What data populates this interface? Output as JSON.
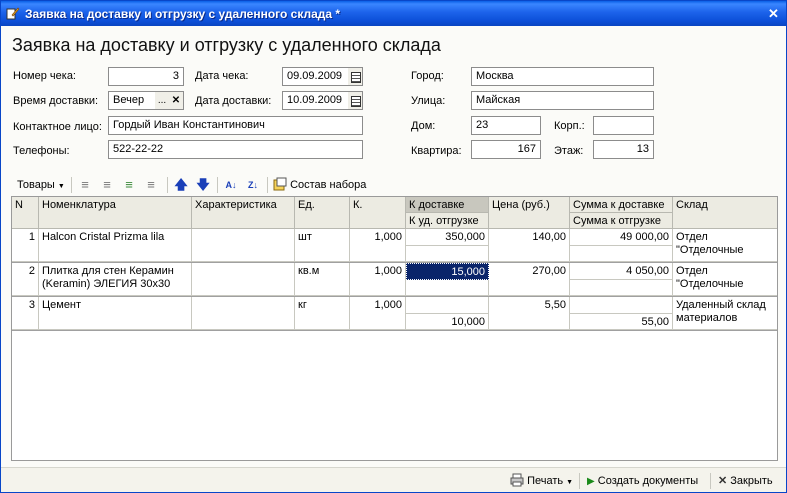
{
  "window": {
    "title": "Заявка на доставку и отгрузку с удаленного склада *",
    "close": "✕"
  },
  "form": {
    "title": "Заявка на доставку и отгрузку с удаленного склада",
    "fields": {
      "check_number_label": "Номер чека:",
      "check_number": "3",
      "check_date_label": "Дата чека:",
      "check_date": "09.09.2009",
      "delivery_time_label": "Время доставки:",
      "delivery_time": "Вечер",
      "delivery_date_label": "Дата доставки:",
      "delivery_date": "10.09.2009",
      "contact_label": "Контактное лицо:",
      "contact": "Гордый Иван Константинович",
      "phones_label": "Телефоны:",
      "phones": "522-22-22",
      "city_label": "Город:",
      "city": "Москва",
      "street_label": "Улица:",
      "street": "Майская",
      "house_label": "Дом:",
      "house": "23",
      "building_label": "Корп.:",
      "building": "",
      "apartment_label": "Квартира:",
      "apartment": "167",
      "floor_label": "Этаж:",
      "floor": "13"
    },
    "select_button": "...",
    "clear_button": "✕"
  },
  "toolbar": {
    "goods_label": "Товары",
    "kit_label": "Состав набора"
  },
  "table": {
    "headers": {
      "n": "N",
      "nomenclature": "Номенклатура",
      "characteristic": "Характеристика",
      "unit": "Ед.",
      "qty": "К.",
      "to_delivery": "К доставке",
      "to_shipment": "К уд. отгрузке",
      "price": "Цена (руб.)",
      "sum_delivery": "Сумма к доставке",
      "sum_shipment": "Сумма к отгрузке",
      "warehouse": "Склад"
    },
    "rows": [
      {
        "n": "1",
        "name": "Halcon Cristal Prizma lila",
        "characteristic": "",
        "unit": "шт",
        "qty": "1,000",
        "to_delivery": "350,000",
        "to_shipment": "",
        "price": "140,00",
        "sum_delivery": "49 000,00",
        "sum_shipment": "",
        "warehouse": "Отдел \"Отделочные"
      },
      {
        "n": "2",
        "name": "Плитка для стен Керамин (Keramin) ЭЛЕГИЯ 30x30",
        "characteristic": "",
        "unit": "кв.м",
        "qty": "1,000",
        "to_delivery": "15,000",
        "to_shipment": "",
        "price": "270,00",
        "sum_delivery": "4 050,00",
        "sum_shipment": "",
        "warehouse": "Отдел \"Отделочные"
      },
      {
        "n": "3",
        "name": "Цемент",
        "characteristic": "",
        "unit": "кг",
        "qty": "1,000",
        "to_delivery": "",
        "to_shipment": "10,000",
        "price": "5,50",
        "sum_delivery": "",
        "sum_shipment": "55,00",
        "warehouse": "Удаленный склад материалов"
      }
    ]
  },
  "footer": {
    "print_label": "Печать",
    "create_docs_label": "Создать документы",
    "close_label": "Закрыть"
  },
  "colors": {
    "titlebar": "#0c4fd8",
    "selection": "#0a246a",
    "accent_green": "#1a8a1a",
    "arrow_blue": "#1a3fb8"
  }
}
